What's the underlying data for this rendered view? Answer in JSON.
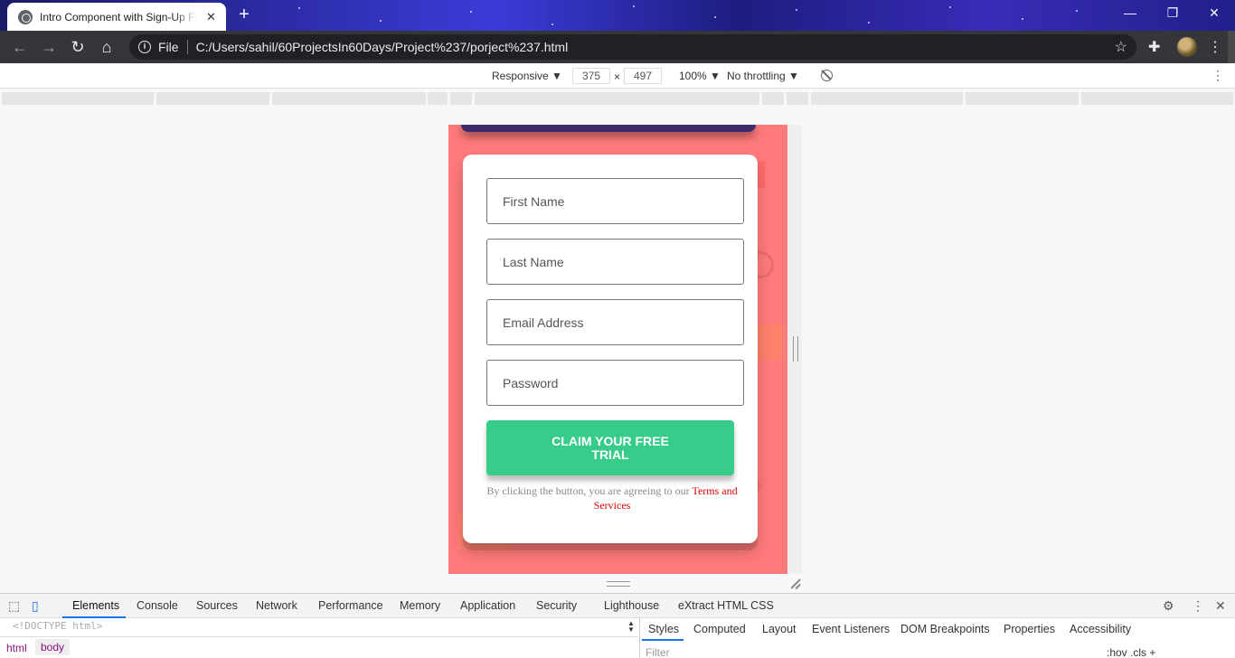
{
  "browser": {
    "tab_title": "Intro Component with Sign-Up Form",
    "tab_close": "✕",
    "new_tab": "+",
    "window_controls": {
      "minimize": "—",
      "restore": "❐",
      "close": "✕"
    },
    "file_label": "File",
    "url": "C:/Users/sahil/60ProjectsIn60Days/Project%237/porject%237.html"
  },
  "device_toolbar": {
    "mode": "Responsive ▼",
    "width": "375",
    "times": "×",
    "height": "497",
    "zoom": "100% ▼",
    "throttle": "No throttling ▼"
  },
  "form": {
    "first_name_placeholder": "First Name",
    "last_name_placeholder": "Last Name",
    "email_placeholder": "Email Address",
    "password_placeholder": "Password",
    "cta_label": "CLAIM YOUR FREE TRIAL",
    "terms_text": "By clicking the button, you are agreeing to our ",
    "terms_link": "Terms and Services",
    "colors": {
      "background": "#ff7a7a",
      "cta": "#38cc8b",
      "link": "#e00000"
    }
  },
  "devtools": {
    "tabs": [
      "Elements",
      "Console",
      "Sources",
      "Network",
      "Performance",
      "Memory",
      "Application",
      "Security",
      "Lighthouse",
      "eXtract HTML CSS"
    ],
    "doctype": "<!DOCTYPE html>",
    "breadcrumbs": [
      "html",
      "body"
    ],
    "style_tabs": [
      "Styles",
      "Computed",
      "Layout",
      "Event Listeners",
      "DOM Breakpoints",
      "Properties",
      "Accessibility"
    ],
    "filter_placeholder": "Filter",
    "style_controls": ":hov  .cls  +"
  }
}
